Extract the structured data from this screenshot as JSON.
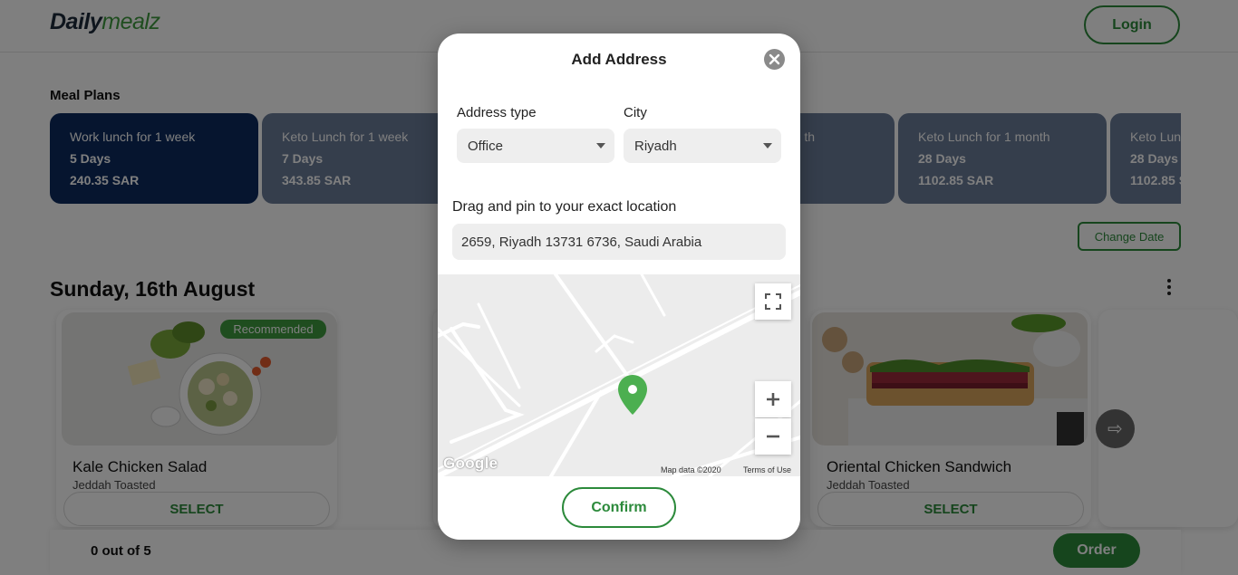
{
  "header": {
    "logo_part1": "Daily",
    "logo_part2": "mealz",
    "login_label": "Login"
  },
  "meal_plans": {
    "title": "Meal Plans",
    "plans": [
      {
        "name": "Work lunch for 1 week",
        "days": "5 Days",
        "price": "240.35 SAR",
        "active": true
      },
      {
        "name": "Keto Lunch for 1 week",
        "days": "7 Days",
        "price": "343.85 SAR",
        "active": false
      },
      {
        "name": "th",
        "days": "",
        "price": "",
        "active": false
      },
      {
        "name": "Keto Lunch for 1 month",
        "days": "28 Days",
        "price": "1102.85 SAR",
        "active": false
      },
      {
        "name": "Keto Lun",
        "days": "28 Days",
        "price": "1102.85 S",
        "active": false
      }
    ]
  },
  "change_date_label": "Change Date",
  "date_heading": "Sunday, 16th August",
  "meals": [
    {
      "name": "Kale Chicken Salad",
      "subtitle": "Jeddah Toasted",
      "select_label": "SELECT",
      "badge": "Recommended"
    },
    {
      "name": "Oriental Chicken Sandwich",
      "subtitle": "Jeddah Toasted",
      "select_label": "SELECT"
    }
  ],
  "bottom_bar": {
    "count": "0 out of 5",
    "order_label": "Order"
  },
  "modal": {
    "title": "Add Address",
    "address_type_label": "Address type",
    "address_type_value": "Office",
    "city_label": "City",
    "city_value": "Riyadh",
    "pin_instruction": "Drag and pin to your exact location",
    "address_value": "2659, Riyadh 13731 6736, Saudi Arabia",
    "map_brand": "Google",
    "map_data_text": "Map data ©2020",
    "terms_text": "Terms of Use",
    "confirm_label": "Confirm"
  },
  "colors": {
    "accent_green": "#2c8a3b",
    "plan_active": "#0c2a5e",
    "plan_inactive": "#6b7c99",
    "pin_green": "#4caf50"
  }
}
